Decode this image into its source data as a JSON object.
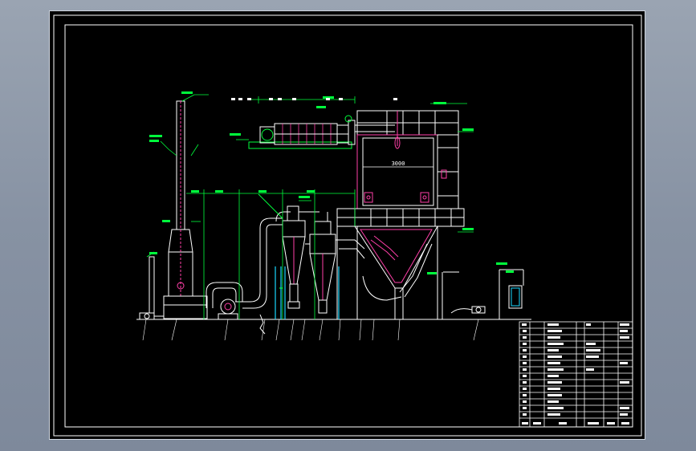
{
  "drawing": {
    "dimension_main": "3000",
    "colors": {
      "background": "#000000",
      "frame": "#ffffff",
      "equipment": "#ff3fa8",
      "annotation": "#00ff3c",
      "structure": "#ffffff",
      "accent_cyan": "#19d8ff",
      "outer_bg": "#8a95a5"
    }
  }
}
